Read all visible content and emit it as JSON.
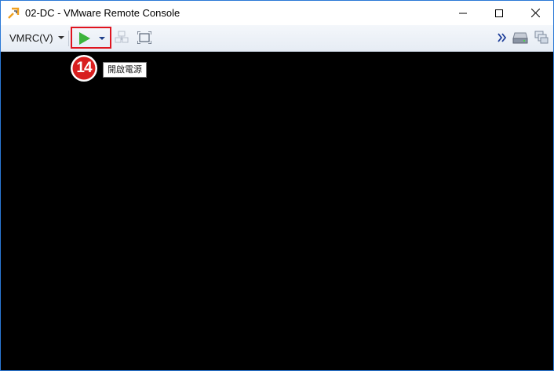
{
  "window": {
    "title": "02-DC - VMware Remote Console",
    "controls": {
      "minimize": "minimize",
      "maximize": "maximize",
      "close": "close"
    }
  },
  "toolbar": {
    "menu_label": "VMRC(V)",
    "power_button": {
      "icon": "play-icon",
      "highlight_color": "#e0141e",
      "play_color": "#3cb43c"
    },
    "icons": [
      "send-ctrl-alt-del-icon",
      "fullscreen-icon",
      "double-chevron-right-icon",
      "removable-drive-icon",
      "virtual-machines-icon"
    ]
  },
  "annotation": {
    "step_number": "14",
    "badge_color": "#d81e1e",
    "tooltip": "開啟電源"
  },
  "console": {
    "background": "#000000"
  }
}
